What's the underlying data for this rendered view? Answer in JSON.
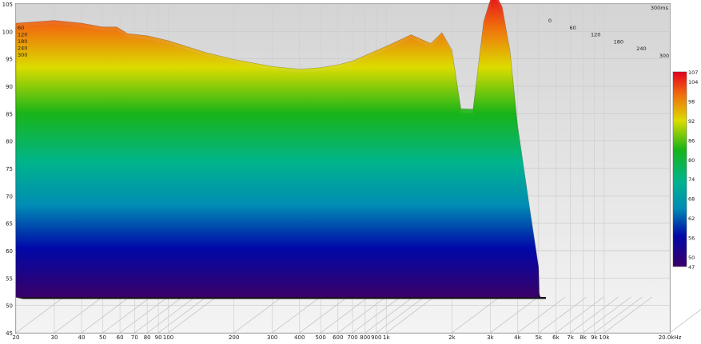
{
  "chart_data": {
    "type": "area",
    "plot_style": "waterfall (cumulative spectral decay)",
    "title": "",
    "time_range_label": "300ms",
    "xlabel": "",
    "x_unit": "kHz",
    "x_scale": "log",
    "x_range": [
      20,
      20000
    ],
    "x_ticks": [
      {
        "value": 20,
        "label": "20"
      },
      {
        "value": 30,
        "label": "30"
      },
      {
        "value": 40,
        "label": "40"
      },
      {
        "value": 50,
        "label": "50"
      },
      {
        "value": 60,
        "label": "60"
      },
      {
        "value": 70,
        "label": "70"
      },
      {
        "value": 80,
        "label": "80"
      },
      {
        "value": 90,
        "label": "90"
      },
      {
        "value": 100,
        "label": "100"
      },
      {
        "value": 200,
        "label": "200"
      },
      {
        "value": 300,
        "label": "300"
      },
      {
        "value": 400,
        "label": "400"
      },
      {
        "value": 500,
        "label": "500"
      },
      {
        "value": 600,
        "label": "600"
      },
      {
        "value": 700,
        "label": "700"
      },
      {
        "value": 800,
        "label": "800"
      },
      {
        "value": 900,
        "label": "900"
      },
      {
        "value": 1000,
        "label": "1k"
      },
      {
        "value": 2000,
        "label": "2k"
      },
      {
        "value": 3000,
        "label": "3k"
      },
      {
        "value": 4000,
        "label": "4k"
      },
      {
        "value": 5000,
        "label": "5k"
      },
      {
        "value": 6000,
        "label": "6k"
      },
      {
        "value": 7000,
        "label": "7k"
      },
      {
        "value": 8000,
        "label": "8k"
      },
      {
        "value": 9000,
        "label": "9k"
      },
      {
        "value": 10000,
        "label": "10k"
      },
      {
        "value": 20000,
        "label": "20.0kHz"
      }
    ],
    "ylabel": "",
    "y_range": [
      45,
      105
    ],
    "y_ticks": [
      "45",
      "50",
      "55",
      "60",
      "65",
      "70",
      "75",
      "80",
      "85",
      "90",
      "95",
      "100",
      "105"
    ],
    "time_ticks_right": [
      "0",
      "60",
      "120",
      "180",
      "240",
      "300"
    ],
    "time_ticks_left": [
      "60",
      "120",
      "180",
      "240",
      "300"
    ],
    "colorbar": {
      "min": 47,
      "max": 107,
      "ticks": [
        "107",
        "104",
        "98",
        "92",
        "86",
        "80",
        "74",
        "68",
        "62",
        "56",
        "50",
        "47"
      ]
    },
    "series": [
      {
        "slice_ms": 0,
        "x": [
          20,
          30,
          40,
          50,
          58,
          65,
          80,
          100,
          150,
          200,
          300,
          400,
          500,
          600,
          700,
          800,
          1000,
          1300,
          1600,
          1800,
          2000,
          2200,
          2500,
          2800,
          3100,
          3400,
          3700,
          4000,
          4500,
          5000
        ],
        "y": [
          101.5,
          102,
          101.5,
          100.8,
          100.8,
          99.6,
          99.2,
          98.3,
          96.1,
          94.9,
          93.6,
          93.1,
          93.4,
          93.9,
          94.6,
          95.6,
          97.3,
          99.4,
          97.8,
          99.8,
          96.6,
          85.9,
          85.8,
          101.9,
          107.5,
          104.5,
          96.3,
          83,
          69,
          57
        ]
      }
    ],
    "grid": true
  }
}
